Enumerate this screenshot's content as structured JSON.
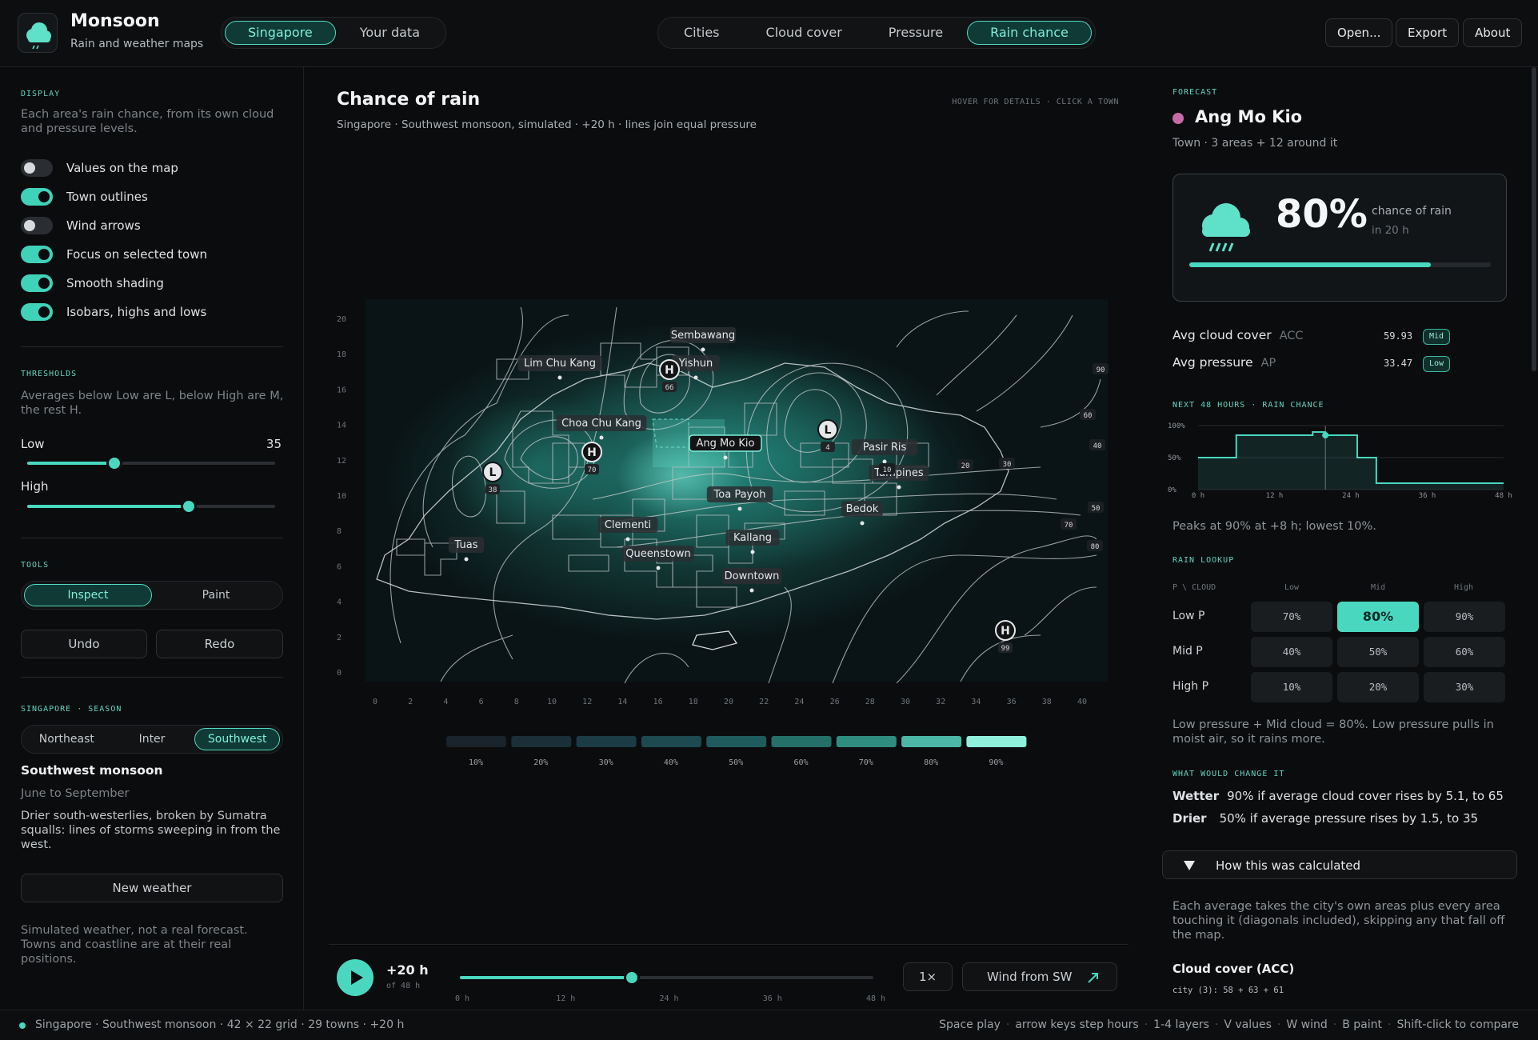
{
  "app": {
    "name": "Monsoon",
    "subtitle": "Rain and weather maps"
  },
  "header": {
    "scope_tabs": [
      "Singapore",
      "Your data"
    ],
    "scope_active": 0,
    "layer_tabs": [
      "Cities",
      "Cloud cover",
      "Pressure",
      "Rain chance"
    ],
    "layer_active": 3,
    "buttons": {
      "open": "Open...",
      "export": "Export",
      "about": "About"
    }
  },
  "left": {
    "display_heading": "DISPLAY",
    "display_desc": "Each area's rain chance, from its own cloud and pressure levels.",
    "toggles": [
      {
        "label": "Values on the map",
        "on": false
      },
      {
        "label": "Town outlines",
        "on": true
      },
      {
        "label": "Wind arrows",
        "on": false
      },
      {
        "label": "Focus on selected town",
        "on": true
      },
      {
        "label": "Smooth shading",
        "on": true
      },
      {
        "label": "Isobars, highs and lows",
        "on": true
      }
    ],
    "thresholds_heading": "THRESHOLDS",
    "thresholds_desc": "Averages below Low are L, below High are M, the rest H.",
    "low_label": "Low",
    "low_value": "35",
    "low_fraction": 0.35,
    "high_label": "High",
    "high_value": "65",
    "high_fraction": 0.65,
    "tools_heading": "TOOLS",
    "tools": [
      "Inspect",
      "Paint"
    ],
    "tools_active": 0,
    "undo": "Undo",
    "redo": "Redo",
    "season_heading": "SINGAPORE  ·  SEASON",
    "seasons": [
      "Northeast",
      "Inter",
      "Southwest"
    ],
    "season_active": 2,
    "season_title": "Southwest monsoon",
    "season_months": "June to September",
    "season_desc": "Drier south-westerlies, broken by Sumatra squalls: lines of storms sweeping in from the west.",
    "new_weather": "New weather",
    "footnote": "Simulated weather, not a real forecast. Towns and coastline are at their real positions."
  },
  "center": {
    "title": "Chance of rain",
    "subtitle": "Singapore  ·  Southwest monsoon, simulated  ·  +20 h  ·  lines join equal pressure",
    "hint": "HOVER FOR DETAILS  ·  CLICK A TOWN",
    "x_ticks": [
      "0",
      "2",
      "4",
      "6",
      "8",
      "10",
      "12",
      "14",
      "16",
      "18",
      "20",
      "22",
      "24",
      "26",
      "28",
      "30",
      "32",
      "34",
      "36",
      "38",
      "40"
    ],
    "y_ticks": [
      "0",
      "2",
      "4",
      "6",
      "8",
      "10",
      "12",
      "14",
      "16",
      "18",
      "20"
    ],
    "towns": [
      "Sembawang",
      "Yishun",
      "Lim Chu Kang",
      "Choa Chu Kang",
      "Ang Mo Kio",
      "Pasir Ris",
      "Tampines",
      "Toa Payoh",
      "Bedok",
      "Clementi",
      "Kallang",
      "Tuas",
      "Queenstown",
      "Downtown"
    ],
    "selected_town": "Ang Mo Kio",
    "pressure_centers": [
      {
        "kind": "H",
        "value": "66"
      },
      {
        "kind": "H",
        "value": "70"
      },
      {
        "kind": "L",
        "value": "38"
      },
      {
        "kind": "L",
        "value": "4"
      },
      {
        "kind": "H",
        "value": "99"
      }
    ],
    "isobar_labels": [
      "90",
      "60",
      "40",
      "50",
      "70",
      "80",
      "10",
      "20",
      "30",
      "20",
      "30"
    ],
    "legend": [
      "10%",
      "20%",
      "30%",
      "40%",
      "50%",
      "60%",
      "70%",
      "80%",
      "90%"
    ],
    "legend_colors": [
      "#18232b",
      "#1a2f37",
      "#1b3c44",
      "#1c4a50",
      "#1f5b5c",
      "#247068",
      "#2f8d80",
      "#4cb7a7",
      "#8ff0dc"
    ]
  },
  "playback": {
    "time": "+20 h",
    "of": "of 48 h",
    "progress_fraction": 0.4167,
    "ticks": [
      "0 h",
      "12 h",
      "24 h",
      "36 h",
      "48 h"
    ],
    "speed": "1×",
    "wind": "Wind from SW"
  },
  "right": {
    "forecast_heading": "FORECAST",
    "town": "Ang Mo Kio",
    "town_meta": "Town  ·  3 areas + 12 around it",
    "chance": "80%",
    "chance_label": "chance of rain",
    "chance_when": "in 20 h",
    "chance_fraction": 0.8,
    "avg_cloud_label": "Avg cloud cover",
    "avg_cloud_code": "ACC",
    "avg_cloud_value": "59.93",
    "avg_cloud_level": "Mid",
    "avg_press_label": "Avg pressure",
    "avg_press_code": "AP",
    "avg_press_value": "33.47",
    "avg_press_level": "Low",
    "next48_heading": "NEXT 48 HOURS  ·  RAIN CHANCE",
    "next48_y": [
      "100%",
      "50%",
      "0%"
    ],
    "next48_x": [
      "0 h",
      "12 h",
      "24 h",
      "36 h",
      "48 h"
    ],
    "next48_summary": "Peaks at 90% at +8 h; lowest 10%.",
    "lookup_heading": "RAIN LOOKUP",
    "lookup_corner": "P \\ CLOUD",
    "lookup_cols": [
      "Low",
      "Mid",
      "High"
    ],
    "lookup_rows": [
      "Low P",
      "Mid P",
      "High P"
    ],
    "lookup_cells": [
      [
        "70%",
        "80%",
        "90%"
      ],
      [
        "40%",
        "50%",
        "60%"
      ],
      [
        "10%",
        "20%",
        "30%"
      ]
    ],
    "lookup_note": "Low pressure + Mid cloud = 80%. Low pressure pulls in moist air, so it rains more.",
    "change_heading": "WHAT WOULD CHANGE IT",
    "wetter_label": "Wetter",
    "wetter_text": "90% if average cloud cover rises by 5.1, to 65",
    "drier_label": "Drier",
    "drier_text": "50% if average pressure rises by 1.5, to 35",
    "calc_toggle": "How this was calculated",
    "calc_desc": "Each average takes the city's own areas plus every area touching it (diagonals included), skipping any that fall off the map.",
    "cloud_title": "Cloud cover (ACC)",
    "cloud_formula": "city (3): 58 + 63 + 61"
  },
  "chart_data": {
    "type": "line",
    "title": "",
    "xlabel": "",
    "ylabel": "",
    "x": [
      0,
      4,
      6,
      18,
      20,
      25,
      28,
      48
    ],
    "series": [
      {
        "values": [
          50,
          50,
          85,
          90,
          85,
          50,
          10,
          10
        ]
      }
    ],
    "xlim": [
      0,
      48
    ],
    "ylim": [
      0,
      100
    ],
    "y_ticks": [
      "0%",
      "50%",
      "100%"
    ],
    "x_ticks": [
      "0 h",
      "12 h",
      "24 h",
      "36 h",
      "48 h"
    ],
    "marker_x": 20
  },
  "statusbar": {
    "left": "Singapore  ·  Southwest monsoon  ·  42 × 22 grid  ·  29 towns  ·  +20 h",
    "shortcuts": [
      "Space play",
      "arrow keys step hours",
      "1-4 layers",
      "V values",
      "W wind",
      "B paint",
      "Shift-click to compare"
    ]
  }
}
